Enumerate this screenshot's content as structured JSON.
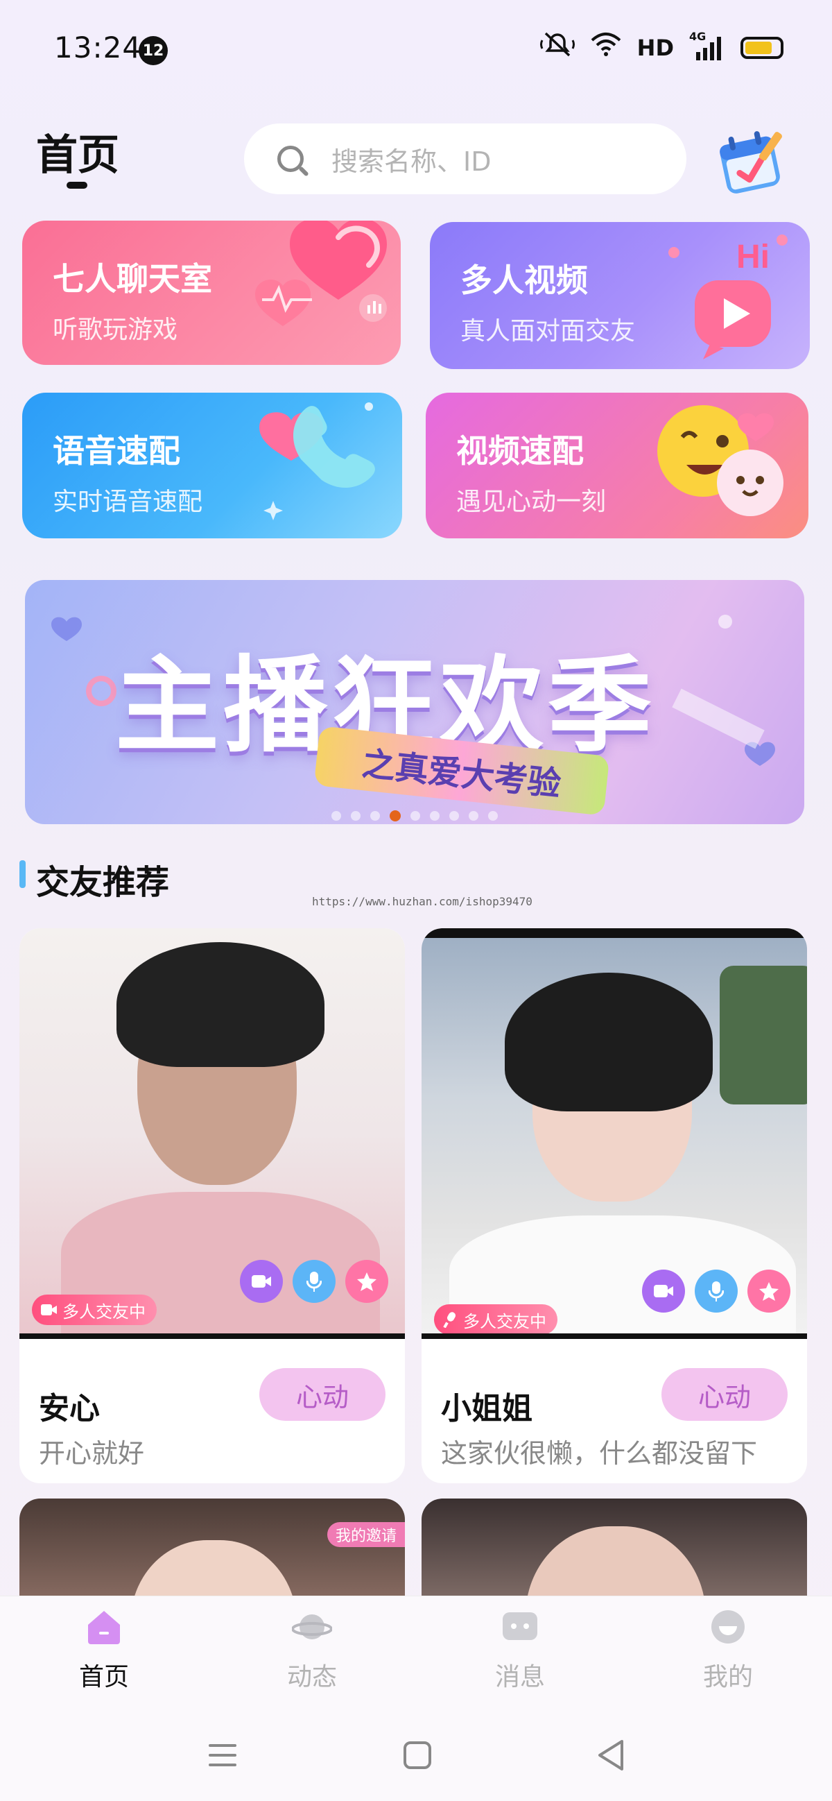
{
  "status_bar": {
    "time": "13:24",
    "notification_count": "12",
    "network": "HD",
    "signal": "4G"
  },
  "header": {
    "title": "首页",
    "search_placeholder": "搜索名称、ID"
  },
  "features": [
    {
      "title": "七人聊天室",
      "subtitle": "听歌玩游戏"
    },
    {
      "title": "多人视频",
      "subtitle": "真人面对面交友",
      "badge": "Hi"
    },
    {
      "title": "语音速配",
      "subtitle": "实时语音速配"
    },
    {
      "title": "视频速配",
      "subtitle": "遇见心动一刻"
    }
  ],
  "banner": {
    "title": "主播狂欢季",
    "subtitle": "之真爱大考验"
  },
  "section": {
    "title": "交友推荐",
    "watermark": "https://www.huzhan.com/ishop39470"
  },
  "profiles": [
    {
      "name": "安心",
      "bio": "开心就好",
      "badge": "多人交友中",
      "action": "心动"
    },
    {
      "name": "小姐姐",
      "bio": "这家伙很懒，什么都没留下",
      "badge": "多人交友中",
      "action": "心动"
    },
    {
      "overlay": "我的邀请"
    }
  ],
  "nav": [
    {
      "label": "首页",
      "icon": "home-icon",
      "active": true
    },
    {
      "label": "动态",
      "icon": "planet-icon",
      "active": false
    },
    {
      "label": "消息",
      "icon": "message-icon",
      "active": false
    },
    {
      "label": "我的",
      "icon": "profile-icon",
      "active": false
    }
  ],
  "colors": {
    "accent_pink": "#fa6f95",
    "accent_purple": "#8b7af9",
    "accent_blue": "#2b9cf8",
    "heart_button": "#f3c4ef"
  }
}
